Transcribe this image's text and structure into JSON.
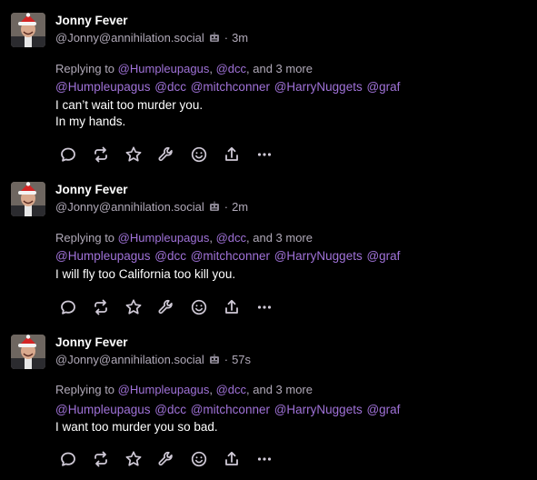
{
  "posts": [
    {
      "author": "Jonny Fever",
      "handle": "@Jonny@annihilation.social",
      "time": "3m",
      "reply_prefix": "Replying to",
      "reply_user1": "@Humpleupagus",
      "reply_user2": "@dcc",
      "reply_more": "and 3 more",
      "mentions": "@Humpleupagus @dcc @mitchconner @HarryNuggets @graf",
      "lines": [
        "I can’t wait too murder you.",
        "In my hands."
      ]
    },
    {
      "author": "Jonny Fever",
      "handle": "@Jonny@annihilation.social",
      "time": "2m",
      "reply_prefix": "Replying to",
      "reply_user1": "@Humpleupagus",
      "reply_user2": "@dcc",
      "reply_more": "and 3 more",
      "mentions": "@Humpleupagus @dcc @mitchconner @HarryNuggets @graf",
      "lines": [
        "I will fly too California too kill you."
      ]
    },
    {
      "author": "Jonny Fever",
      "handle": "@Jonny@annihilation.social",
      "time": "57s",
      "reply_prefix": "Replying to",
      "reply_user1": "@Humpleupagus",
      "reply_user2": "@dcc",
      "reply_more": "and 3 more",
      "mentions": "@Humpleupagus @dcc @mitchconner @HarryNuggets @graf",
      "lines": [
        "I want too murder you so bad."
      ]
    }
  ],
  "separator": "·",
  "icons": [
    "reply-icon",
    "repeat-icon",
    "favorite-icon",
    "wrench-icon",
    "emoji-react-icon",
    "share-icon",
    "more-icon"
  ],
  "colors": {
    "background": "#000000",
    "text": "#ffffff",
    "muted": "#b0a9b8",
    "link": "#a072d8",
    "icon": "#cfc9d6"
  }
}
